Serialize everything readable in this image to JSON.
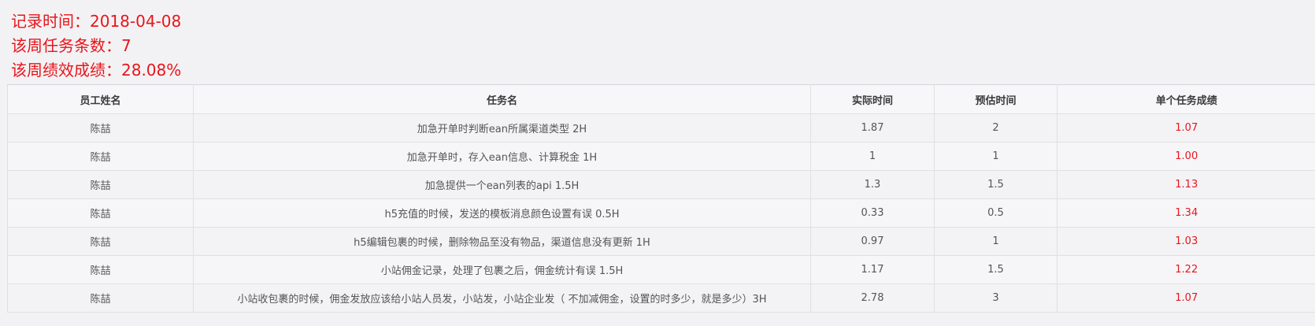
{
  "summary": {
    "record_time": "记录时间：2018-04-08",
    "task_count": "该周任务条数：7",
    "performance": "该周绩效成绩：28.08%"
  },
  "colors": {
    "accent_red": "#e8151b",
    "background": "#f2f2f4",
    "border": "#e0e0e3"
  },
  "table": {
    "headers": {
      "employee": "员工姓名",
      "task": "任务名",
      "actual": "实际时间",
      "estimated": "预估时间",
      "score": "单个任务成绩"
    },
    "rows": [
      {
        "employee": "陈喆",
        "task": "加急开单时判断ean所属渠道类型 2H",
        "actual": "1.87",
        "estimated": "2",
        "score": "1.07"
      },
      {
        "employee": "陈喆",
        "task": "加急开单时，存入ean信息、计算税金 1H",
        "actual": "1",
        "estimated": "1",
        "score": "1.00"
      },
      {
        "employee": "陈喆",
        "task": "加急提供一个ean列表的api 1.5H",
        "actual": "1.3",
        "estimated": "1.5",
        "score": "1.13"
      },
      {
        "employee": "陈喆",
        "task": "h5充值的时候，发送的模板消息颜色设置有误 0.5H",
        "actual": "0.33",
        "estimated": "0.5",
        "score": "1.34"
      },
      {
        "employee": "陈喆",
        "task": "h5编辑包裹的时候，删除物品至没有物品，渠道信息没有更新 1H",
        "actual": "0.97",
        "estimated": "1",
        "score": "1.03"
      },
      {
        "employee": "陈喆",
        "task": "小站佣金记录，处理了包裹之后，佣金统计有误 1.5H",
        "actual": "1.17",
        "estimated": "1.5",
        "score": "1.22"
      },
      {
        "employee": "陈喆",
        "task": "小站收包裹的时候，佣金发放应该给小站人员发，小站发，小站企业发（ 不加减佣金，设置的时多少，就是多少）3H",
        "actual": "2.78",
        "estimated": "3",
        "score": "1.07"
      }
    ]
  }
}
